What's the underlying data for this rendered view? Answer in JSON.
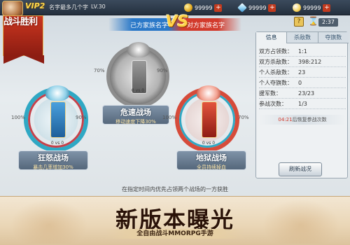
{
  "header": {
    "vip": "VIP2",
    "player_name": "名字最多几个字",
    "level": "LV.30",
    "gold": "99999",
    "diamond": "99999",
    "stamina": "99999",
    "plus": "+"
  },
  "banner": {
    "title": "战斗胜利"
  },
  "versus": {
    "left_name": "己方家族名字",
    "vs": "VS",
    "right_name": "对方家族名字"
  },
  "fields": {
    "center": {
      "name": "危速战场",
      "desc": "移动速度下降30%",
      "left_pct": "70%",
      "right_pct": "90%",
      "score": "0 vs 0"
    },
    "left": {
      "name": "狂怒战场",
      "desc": "暴击几率增加30%",
      "left_pct": "100%",
      "right_pct": "90%",
      "score": "0 vs 0"
    },
    "right": {
      "name": "地狱战场",
      "desc": "全员持续掉血",
      "left_pct": "100%",
      "right_pct": "70%",
      "score": "0 vs 0"
    }
  },
  "panel": {
    "tabs": [
      "信息",
      "杀敌数",
      "夺旗数"
    ],
    "rows": [
      {
        "k": "双方占领数：",
        "v": "1:1"
      },
      {
        "k": "双方杀敌数：",
        "v": "398:212"
      },
      {
        "k": "个人杀敌数：",
        "v": "23"
      },
      {
        "k": "个人夺旗数：",
        "v": "0"
      },
      {
        "k": "援军数：",
        "v": "23/23"
      },
      {
        "k": "参战次数：",
        "v": "1/3"
      }
    ],
    "revive_time": "04:21",
    "revive_text": "后恢复参战次数",
    "refresh": "刷新战况"
  },
  "top_icons": {
    "help": "?",
    "timer": "2:37"
  },
  "rule": "在指定时间内优先占领两个战场的一方获胜",
  "promo": {
    "title": "新版本曝光",
    "subtitle": "全自由战斗MMORPG手游"
  }
}
